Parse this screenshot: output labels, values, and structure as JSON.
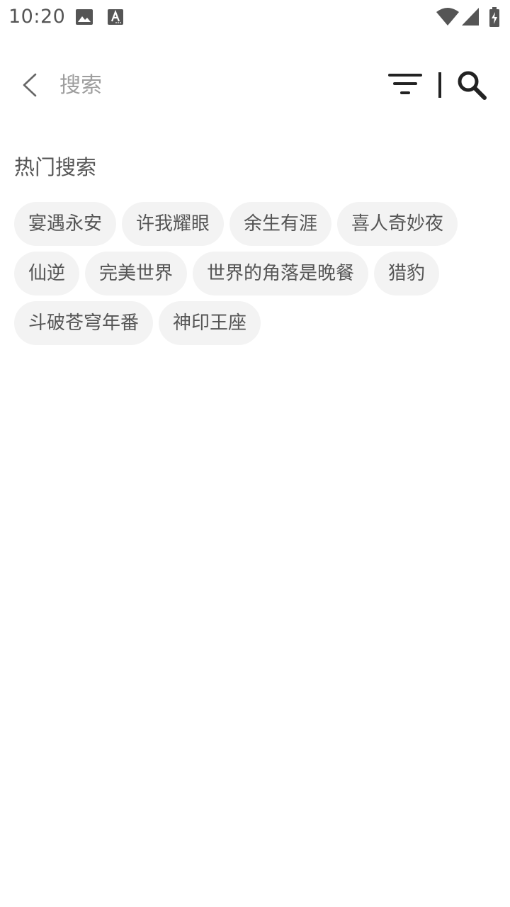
{
  "status_bar": {
    "time": "10:20",
    "icons": [
      "image-icon",
      "a-notification-icon",
      "wifi-icon",
      "cell-signal-icon",
      "battery-charging-icon"
    ]
  },
  "header": {
    "search_placeholder": "搜索",
    "icons": [
      "back-chevron-icon",
      "filter-icon",
      "search-icon"
    ]
  },
  "hot_search": {
    "title": "热门搜索",
    "tags": [
      "宴遇永安",
      "许我耀眼",
      "余生有涯",
      "喜人奇妙夜",
      "仙逆",
      "完美世界",
      "世界的角落是晚餐",
      "猎豹",
      "斗破苍穹年番",
      "神印王座"
    ]
  },
  "colors": {
    "background": "#ffffff",
    "tag_background": "#f3f3f3",
    "tag_text": "#555555",
    "placeholder": "#9e9e9e"
  }
}
